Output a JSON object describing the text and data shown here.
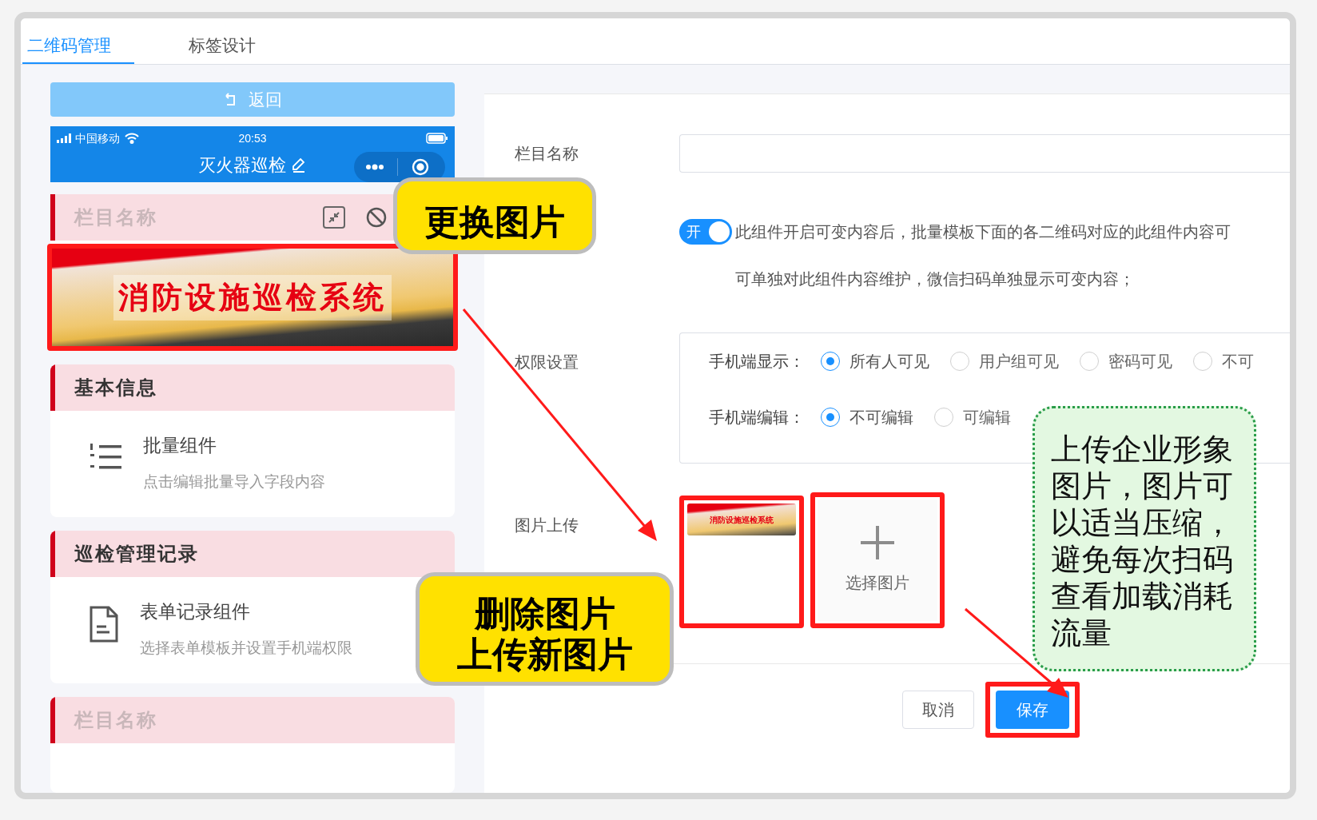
{
  "tabs": [
    {
      "label": "二维码管理",
      "selected": true
    },
    {
      "label": "标签设计",
      "selected": false
    }
  ],
  "back_button": {
    "label": "返回"
  },
  "phone": {
    "carrier": "中国移动",
    "time": "20:53",
    "title": "灭火器巡检"
  },
  "sections": [
    {
      "kind": "image",
      "title": "栏目名称",
      "muted": true,
      "banner_text": "消防设施巡检系统"
    },
    {
      "kind": "batch",
      "title": "基本信息",
      "muted": false,
      "item_title": "批量组件",
      "item_hint": "点击编辑批量导入字段内容"
    },
    {
      "kind": "form",
      "title": "巡检管理记录",
      "muted": false,
      "item_title": "表单记录组件",
      "item_hint": "选择表单模板并设置手机端权限"
    },
    {
      "kind": "empty",
      "title": "栏目名称",
      "muted": true
    }
  ],
  "form": {
    "name_label": "栏目名称",
    "toggle": {
      "label": "开",
      "on": true,
      "description": "此组件开启可变内容后，批量模板下面的各二维码对应的此组件内容可",
      "description_2": "可单独对此组件内容维护，微信扫码单独显示可变内容；"
    },
    "permission_label": "权限设置",
    "permission_rows": [
      {
        "label": "手机端显示：",
        "options": [
          {
            "label": "所有人可见",
            "selected": true
          },
          {
            "label": "用户组可见",
            "selected": false
          },
          {
            "label": "密码可见",
            "selected": false
          },
          {
            "label": "不可",
            "selected": false
          }
        ]
      },
      {
        "label": "手机端编辑：",
        "options": [
          {
            "label": "不可编辑",
            "selected": true
          },
          {
            "label": "可编辑",
            "selected": false
          }
        ]
      }
    ],
    "upload_label": "图片上传",
    "thumbnail_text": "消防设施巡检系统",
    "add_label": "选择图片",
    "cancel_button": "取消",
    "save_button": "保存"
  },
  "annotations": {
    "replace_callout": [
      "更换图片"
    ],
    "delete_callout": [
      "删除图片",
      "上传新图片"
    ],
    "note": [
      "上传企业形象",
      "图片，图片可",
      "以适当压缩，",
      "避免每次扫码",
      "查看加载消耗",
      "流量"
    ]
  }
}
